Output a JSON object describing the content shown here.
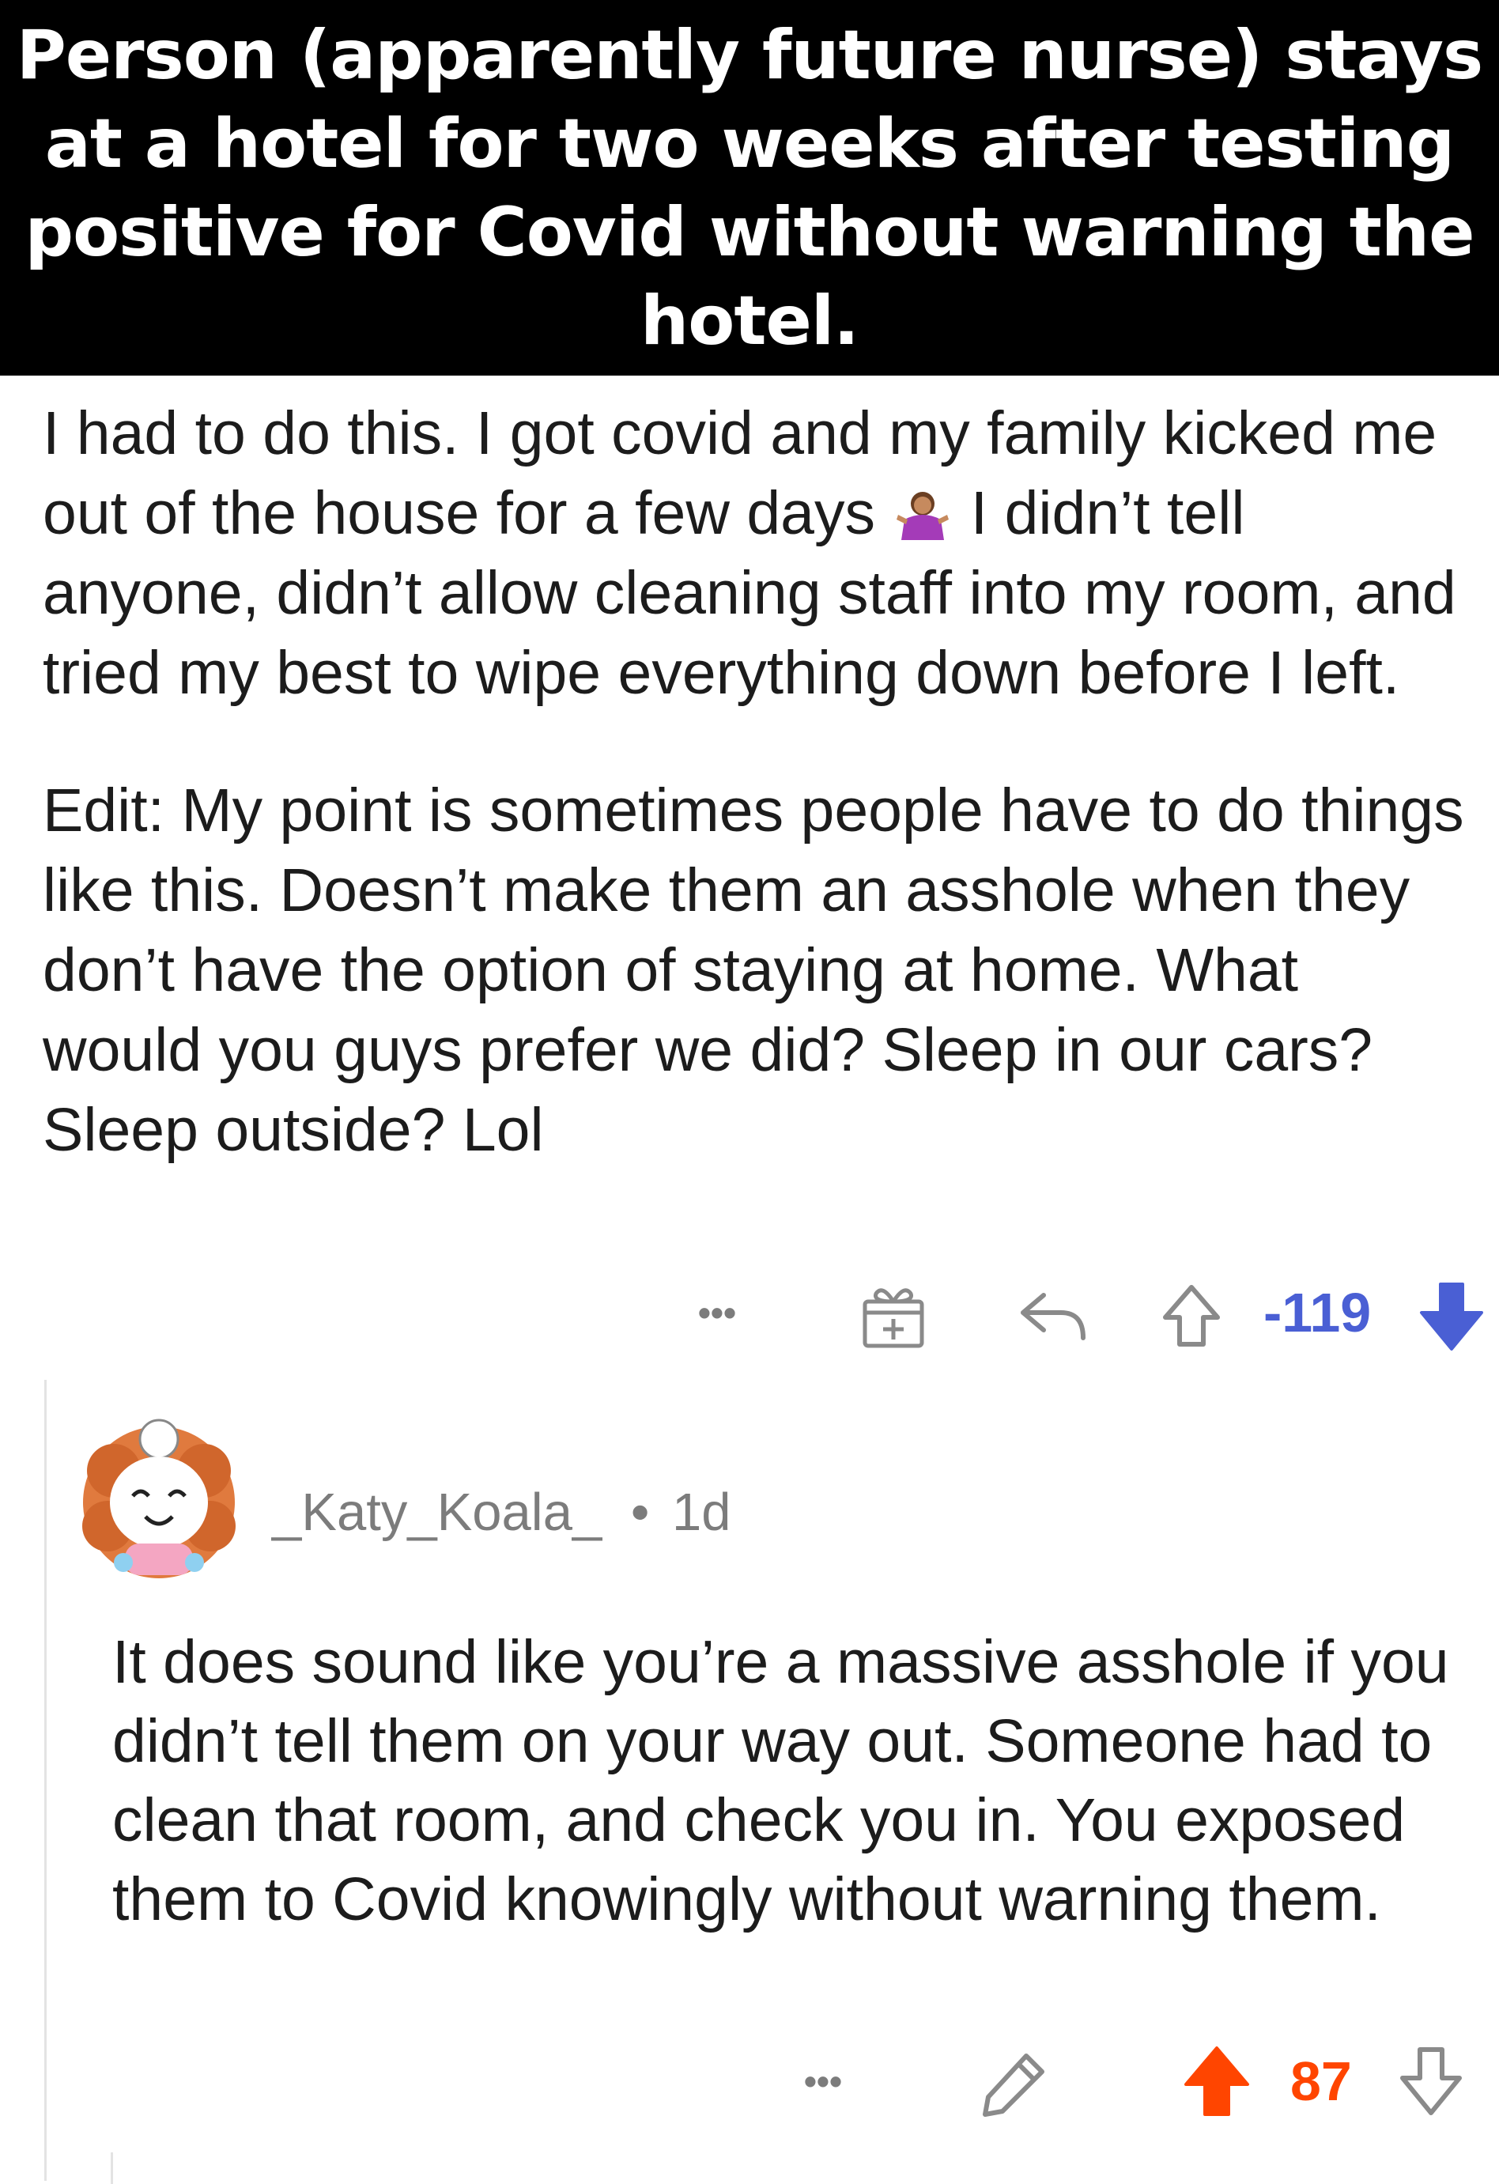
{
  "banner": {
    "title": "Person (apparently future nurse) stays at a hotel for two weeks after testing positive for Covid without warning the hotel."
  },
  "post": {
    "paragraph1_before_emoji": "I had to do this. I got covid and my family kicked me out of the house for a few days",
    "paragraph1_after_emoji": "I didn’t tell anyone, didn’t allow cleaning staff into my room, and tried my best to wipe everything down before I left.",
    "paragraph2": "Edit: My point is sometimes people have to do things like this. Doesn’t make them an asshole when they don’t have the option of staying at home. What would you guys prefer we did? Sleep in our cars? Sleep outside? Lol",
    "emoji_icon": "person-shrugging-emoji",
    "actions": {
      "more_label": "•••",
      "award_icon": "gift-award-icon",
      "reply_icon": "reply-arrow-icon",
      "upvote_icon": "upvote-outline-icon",
      "score": "-119",
      "score_color": "#4a5fd4",
      "downvote_icon": "downvote-filled-icon"
    }
  },
  "comment": {
    "author": "_Katy_Koala_",
    "separator": "•",
    "age": "1d",
    "body": "It does sound like you’re a massive asshole if you didn’t tell them on your way out. Someone had to clean that room, and check you in. You exposed them to Covid knowingly without warning them.",
    "actions": {
      "more_label": "•••",
      "edit_icon": "pencil-icon",
      "upvote_icon": "upvote-filled-icon",
      "score": "87",
      "score_color": "#ff4500",
      "downvote_icon": "downvote-outline-icon"
    }
  }
}
